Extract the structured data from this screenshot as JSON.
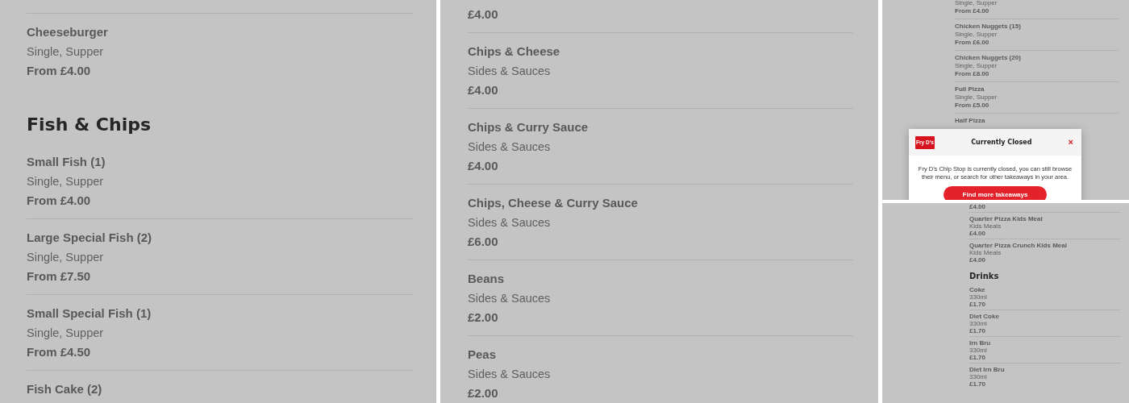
{
  "panels": [
    {
      "entries": [
        {
          "kind": "item",
          "name": "Cheeseburger",
          "description": "Single, Supper",
          "price": "From £4.00"
        },
        {
          "kind": "heading",
          "title": "Fish & Chips"
        },
        {
          "kind": "item",
          "name": "Small Fish (1)",
          "description": "Single, Supper",
          "price": "From £4.00"
        },
        {
          "kind": "item",
          "name": "Large Special Fish (2)",
          "description": "Single, Supper",
          "price": "From £7.50"
        },
        {
          "kind": "item",
          "name": "Small Special Fish (1)",
          "description": "Single, Supper",
          "price": "From £4.50"
        },
        {
          "kind": "item",
          "name": "Fish Cake (2)"
        }
      ]
    },
    {
      "entries": [
        {
          "kind": "item",
          "price": "£4.00"
        },
        {
          "kind": "item",
          "name": "Chips & Cheese",
          "description": "Sides & Sauces",
          "price": "£4.00"
        },
        {
          "kind": "item",
          "name": "Chips & Curry Sauce",
          "description": "Sides & Sauces",
          "price": "£4.00"
        },
        {
          "kind": "item",
          "name": "Chips, Cheese & Curry Sauce",
          "description": "Sides & Sauces",
          "price": "£6.00"
        },
        {
          "kind": "item",
          "name": "Beans",
          "description": "Sides & Sauces",
          "price": "£2.00"
        },
        {
          "kind": "item",
          "name": "Peas",
          "description": "Sides & Sauces",
          "price": "£2.00"
        }
      ]
    },
    {
      "entries": [
        {
          "kind": "item",
          "description": "Single, Supper",
          "price": "From £4.00"
        },
        {
          "kind": "item",
          "name": "Chicken Nuggets (15)",
          "description": "Single, Supper",
          "price": "From £6.00"
        },
        {
          "kind": "item",
          "name": "Chicken Nuggets (20)",
          "description": "Single, Supper",
          "price": "From £8.00"
        },
        {
          "kind": "item",
          "name": "Full Pizza",
          "description": "Single, Supper",
          "price": "From £5.00"
        },
        {
          "kind": "item",
          "name": "Half Pizza"
        }
      ],
      "modal": {
        "logo_text": "Fry D's",
        "title": "Currently Closed",
        "close": "×",
        "message": "Fry D's Chip Stop is currently closed, you can still browse their menu, or search for other takeaways in your area.",
        "button": "Find more takeaways"
      }
    },
    {
      "entries": [
        {
          "kind": "item",
          "price": "£4.00"
        },
        {
          "kind": "item",
          "name": "Quarter Pizza Kids Meal",
          "description": "Kids Meals",
          "price": "£4.00"
        },
        {
          "kind": "item",
          "name": "Quarter Pizza Crunch Kids Meal",
          "description": "Kids Meals",
          "price": "£4.00"
        },
        {
          "kind": "heading",
          "title": "Drinks"
        },
        {
          "kind": "item",
          "name": "Coke",
          "description": "330ml",
          "price": "£1.70"
        },
        {
          "kind": "item",
          "name": "Diet Coke",
          "description": "330ml",
          "price": "£1.70"
        },
        {
          "kind": "item",
          "name": "Irn Bru",
          "description": "330ml",
          "price": "£1.70"
        },
        {
          "kind": "item",
          "name": "Diet Irn Bru",
          "description": "330ml",
          "price": "£1.70"
        }
      ]
    }
  ]
}
